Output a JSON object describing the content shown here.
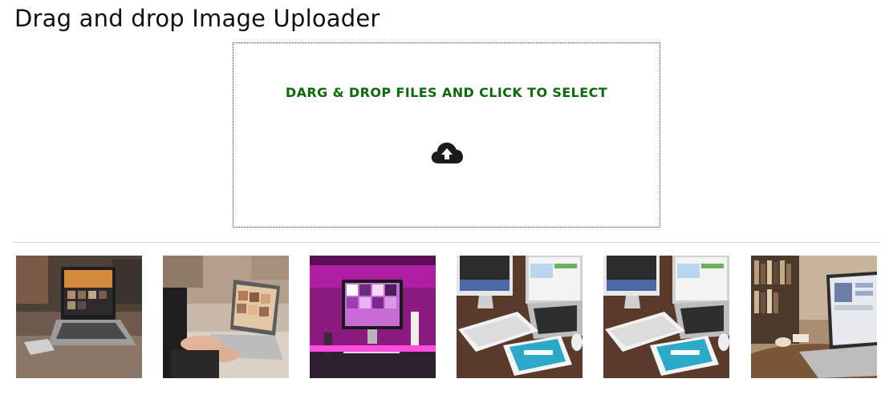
{
  "header": {
    "title": "Drag and drop Image Uploader"
  },
  "dropzone": {
    "label": "DARG & DROP FILES AND CLICK TO SELECT",
    "icon": "cloud-upload-icon"
  },
  "colors": {
    "dropzone_text": "#0b6b0b",
    "divider": "#d4d4d4"
  },
  "gallery": {
    "images": [
      {
        "icon": "laptop-on-wood-table-photo"
      },
      {
        "icon": "person-typing-on-laptop-photo"
      },
      {
        "icon": "monitor-pink-light-desk-photo"
      },
      {
        "icon": "imac-laptop-tablet-desk-photo"
      },
      {
        "icon": "imac-laptop-tablet-desk-photo"
      },
      {
        "icon": "laptop-bookshelf-photo"
      }
    ]
  }
}
